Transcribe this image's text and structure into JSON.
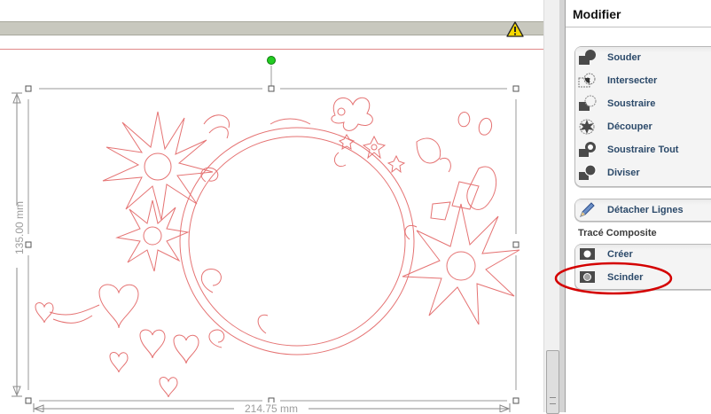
{
  "canvas": {
    "dimension_height": "135.00 mm",
    "dimension_width": "214.75 mm",
    "warning_icon": "warning-icon"
  },
  "panel": {
    "title": "Modifier",
    "modify_items": [
      {
        "label": "Souder",
        "icon": "weld-icon"
      },
      {
        "label": "Intersecter",
        "icon": "intersect-icon"
      },
      {
        "label": "Soustraire",
        "icon": "subtract-icon"
      },
      {
        "label": "Découper",
        "icon": "crop-icon"
      },
      {
        "label": "Soustraire Tout",
        "icon": "subtract-all-icon"
      },
      {
        "label": "Diviser",
        "icon": "divide-icon"
      }
    ],
    "detach": {
      "label": "Détacher Lignes",
      "icon": "pencil-icon"
    },
    "compound_section": "Tracé Composite",
    "compound_items": [
      {
        "label": "Créer",
        "icon": "compound-create-icon"
      },
      {
        "label": "Scinder",
        "icon": "compound-split-icon"
      }
    ]
  },
  "colors": {
    "cut_line": "#e57373",
    "label_text": "#2c4a6a",
    "annotation_red": "#d40000",
    "rotate_handle": "#22cc22"
  }
}
